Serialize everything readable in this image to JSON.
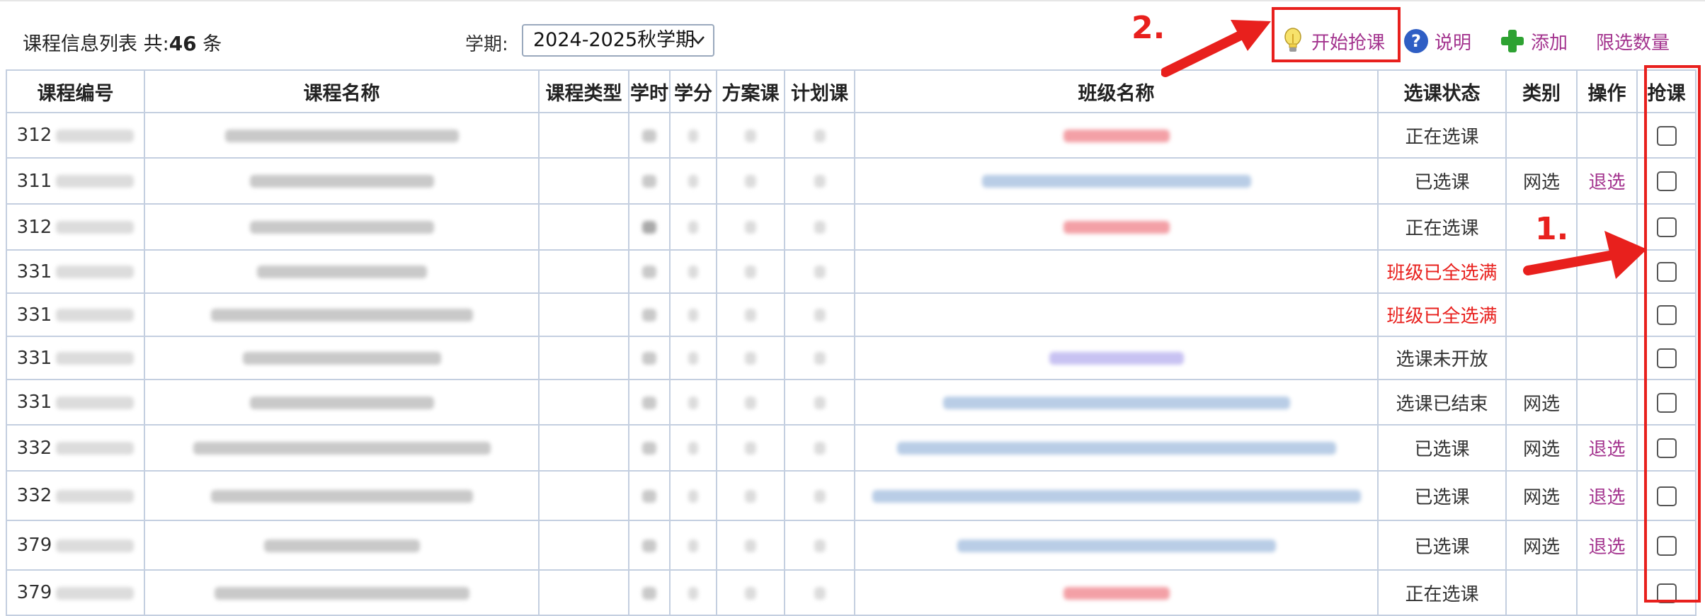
{
  "header": {
    "summary_label": "课程信息列表 共:",
    "summary_count": "46",
    "summary_unit": "条",
    "term_label": "学期:",
    "term_value": "2024-2025秋学期"
  },
  "toolbar": {
    "grab_label": "开始抢课",
    "help_label": "说明",
    "add_label": "添加",
    "limit_label": "限选数量"
  },
  "annotations": {
    "step1": "1.",
    "step2": "2."
  },
  "table": {
    "columns": [
      "课程编号",
      "课程名称",
      "课程类型",
      "学时",
      "学分",
      "方案课",
      "计划课",
      "班级名称",
      "选课状态",
      "类别",
      "操作",
      "抢课"
    ],
    "rows": [
      {
        "code": "312",
        "status": "正在选课",
        "status_color": "normal",
        "category": "",
        "action": ""
      },
      {
        "code": "311",
        "status": "已选课",
        "status_color": "normal",
        "category": "网选",
        "action": "退选"
      },
      {
        "code": "312",
        "status": "正在选课",
        "status_color": "normal",
        "category": "",
        "action": ""
      },
      {
        "code": "331",
        "status": "班级已全选满",
        "status_color": "red",
        "category": "",
        "action": ""
      },
      {
        "code": "331",
        "status": "班级已全选满",
        "status_color": "red",
        "category": "",
        "action": ""
      },
      {
        "code": "331",
        "status": "选课未开放",
        "status_color": "normal",
        "category": "",
        "action": ""
      },
      {
        "code": "331",
        "status": "选课已结束",
        "status_color": "normal",
        "category": "网选",
        "action": ""
      },
      {
        "code": "332",
        "status": "已选课",
        "status_color": "normal",
        "category": "网选",
        "action": "退选"
      },
      {
        "code": "332",
        "status": "已选课",
        "status_color": "normal",
        "category": "网选",
        "action": "退选"
      },
      {
        "code": "379",
        "status": "已选课",
        "status_color": "normal",
        "category": "网选",
        "action": "退选"
      },
      {
        "code": "379",
        "status": "正在选课",
        "status_color": "normal",
        "category": "",
        "action": ""
      }
    ]
  },
  "colors": {
    "accent_link": "#a3338e",
    "annotation_red": "#e8201d",
    "table_border": "#c4cfe0"
  },
  "icons": {
    "grab": "lightbulb-icon",
    "help": "help-circle-icon",
    "add": "plus-icon",
    "term_select": "chevron-down-icon",
    "annotation_arrow": "arrow-icon"
  }
}
